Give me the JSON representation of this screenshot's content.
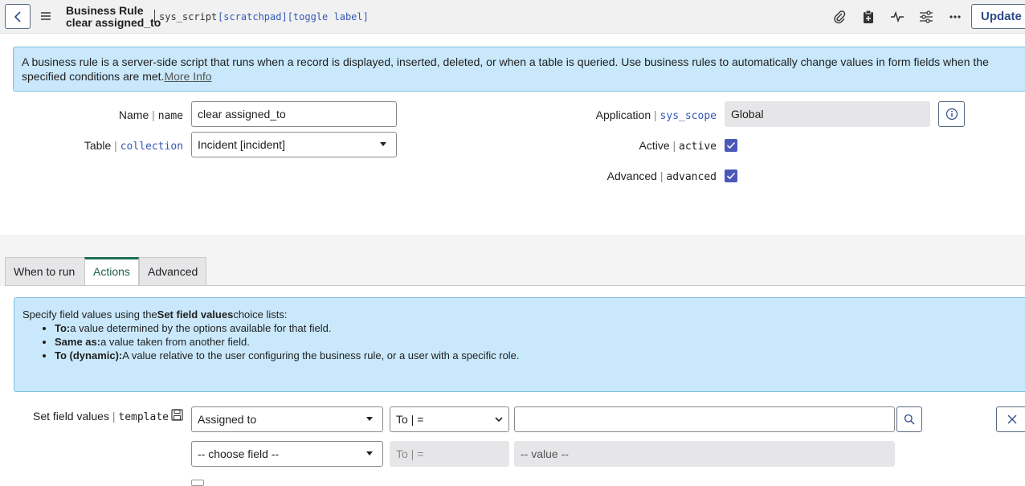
{
  "header": {
    "title_line1": "Business Rule",
    "title_line2": "clear assigned_to",
    "table_name": "sys_script",
    "scratchpad_link": "[scratchpad]",
    "toggle_label_link": "[toggle label]",
    "update_label": "Update",
    "icons": [
      "back-icon",
      "hamburger-icon",
      "paperclip-icon",
      "clipboard-icon",
      "activity-icon",
      "sliders-icon",
      "more-icon"
    ]
  },
  "info_banner": {
    "text": "A business rule is a server-side script that runs when a record is displayed, inserted, deleted, or when a table is queried. Use business rules to automatically change values in form fields when the specified conditions are met.",
    "more_info": "More Info"
  },
  "form": {
    "name": {
      "label": "Name",
      "column": "name",
      "value": "clear assigned_to"
    },
    "table": {
      "label": "Table",
      "column": "collection",
      "value": "Incident [incident]"
    },
    "application": {
      "label": "Application",
      "column": "sys_scope",
      "value": "Global"
    },
    "active": {
      "label": "Active",
      "column": "active",
      "checked": true
    },
    "advanced": {
      "label": "Advanced",
      "column": "advanced",
      "checked": true
    }
  },
  "tabs": [
    {
      "label": "When to run",
      "active": false
    },
    {
      "label": "Actions",
      "active": true
    },
    {
      "label": "Advanced",
      "active": false
    }
  ],
  "actions_info": {
    "intro_prefix": "Specify field values using the",
    "intro_bold": "Set field values",
    "intro_suffix": "choice lists:",
    "items": [
      {
        "term": "To:",
        "desc": "a value determined by the options available for that field."
      },
      {
        "term": "Same as:",
        "desc": "a value taken from another field."
      },
      {
        "term": "To (dynamic):",
        "desc": "A value relative to the user configuring the business rule, or a user with a specific role."
      }
    ]
  },
  "set_field_values": {
    "label": "Set field values",
    "column": "template",
    "row1": {
      "field": "Assigned to",
      "operator": "To | =",
      "value": ""
    },
    "row2": {
      "field": "-- choose field --",
      "operator": "To | =",
      "value": "-- value --"
    }
  },
  "colors": {
    "accent": "#4a58b8",
    "banner_bg": "#c9e8fb",
    "tab_active": "#1f6e52",
    "link": "#3657b5"
  }
}
